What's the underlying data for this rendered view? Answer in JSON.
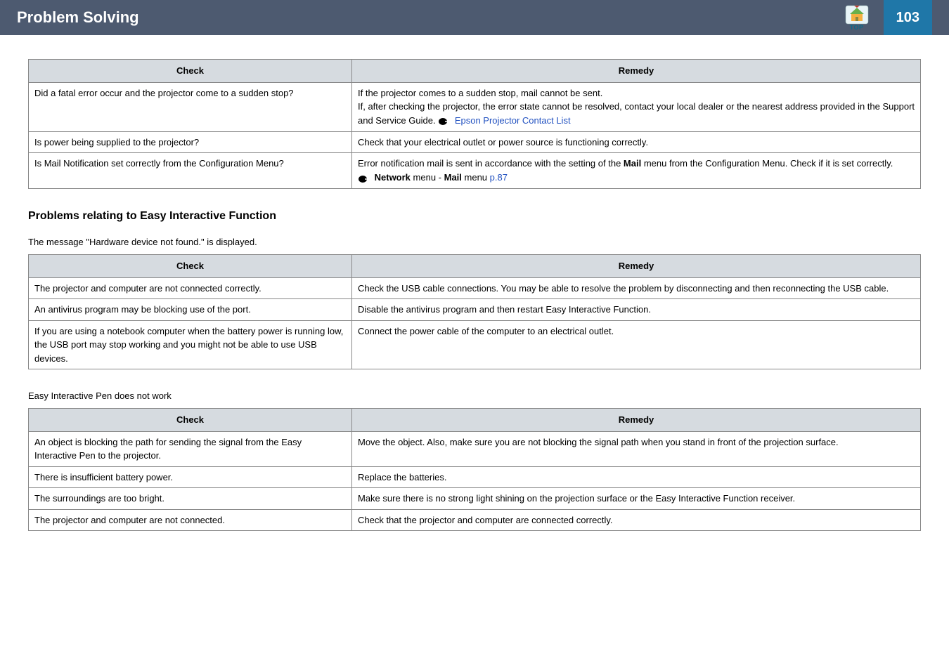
{
  "header": {
    "title": "Problem Solving",
    "top_label": "TOP",
    "page_number": "103"
  },
  "table1": {
    "check_header": "Check",
    "remedy_header": "Remedy",
    "rows": [
      {
        "check": "Did a fatal error occur and the projector come to a sudden stop?",
        "remedy_line1": "If the projector comes to a sudden stop, mail cannot be sent.",
        "remedy_line2a": "If, after checking the projector, the error state cannot be resolved, contact your local dealer or the nearest address provided in the Support and Service Guide. ",
        "remedy_link": "Epson Projector Contact List"
      },
      {
        "check": "Is power being supplied to the projector?",
        "remedy": "Check that your electrical outlet or power source is functioning correctly."
      },
      {
        "check": "Is Mail Notification set correctly from the Configuration Menu?",
        "remedy_line1a": "Error notification mail is sent in accordance with the setting of the ",
        "remedy_line1b": "Mail",
        "remedy_line1c": " menu from the Configuration Menu. Check if it is set correctly.",
        "remedy_link_pre": "Network",
        "remedy_link_mid": " menu - ",
        "remedy_link_bold": "Mail",
        "remedy_link_post": " menu ",
        "remedy_link": "p.87"
      }
    ]
  },
  "section2": {
    "heading": "Problems relating to Easy Interactive Function",
    "sub1": "The message \"Hardware device not found.\" is displayed.",
    "table": {
      "check_header": "Check",
      "remedy_header": "Remedy",
      "rows": [
        {
          "check": "The projector and computer are not connected correctly.",
          "remedy": "Check the USB cable connections. You may be able to resolve the problem by disconnecting and then reconnecting the USB cable."
        },
        {
          "check": "An antivirus program may be blocking use of the port.",
          "remedy": "Disable the antivirus program and then restart Easy Interactive Function."
        },
        {
          "check": "If you are using a notebook computer when the battery power is running low, the USB port may stop working and you might not be able to use USB devices.",
          "remedy": "Connect the power cable of the computer to an electrical outlet."
        }
      ]
    },
    "sub2": "Easy Interactive Pen does not work",
    "table2": {
      "check_header": "Check",
      "remedy_header": "Remedy",
      "rows": [
        {
          "check": "An object is blocking the path for sending the signal from the Easy Interactive Pen to the projector.",
          "remedy": "Move the object. Also, make sure you are not blocking the signal path when you stand in front of the projection surface."
        },
        {
          "check": "There is insufficient battery power.",
          "remedy": "Replace the batteries."
        },
        {
          "check": "The surroundings are too bright.",
          "remedy": "Make sure there is no strong light shining on the projection surface or the Easy Interactive Function receiver."
        },
        {
          "check": "The projector and computer are not connected.",
          "remedy": "Check that the projector and computer are connected correctly."
        }
      ]
    }
  }
}
